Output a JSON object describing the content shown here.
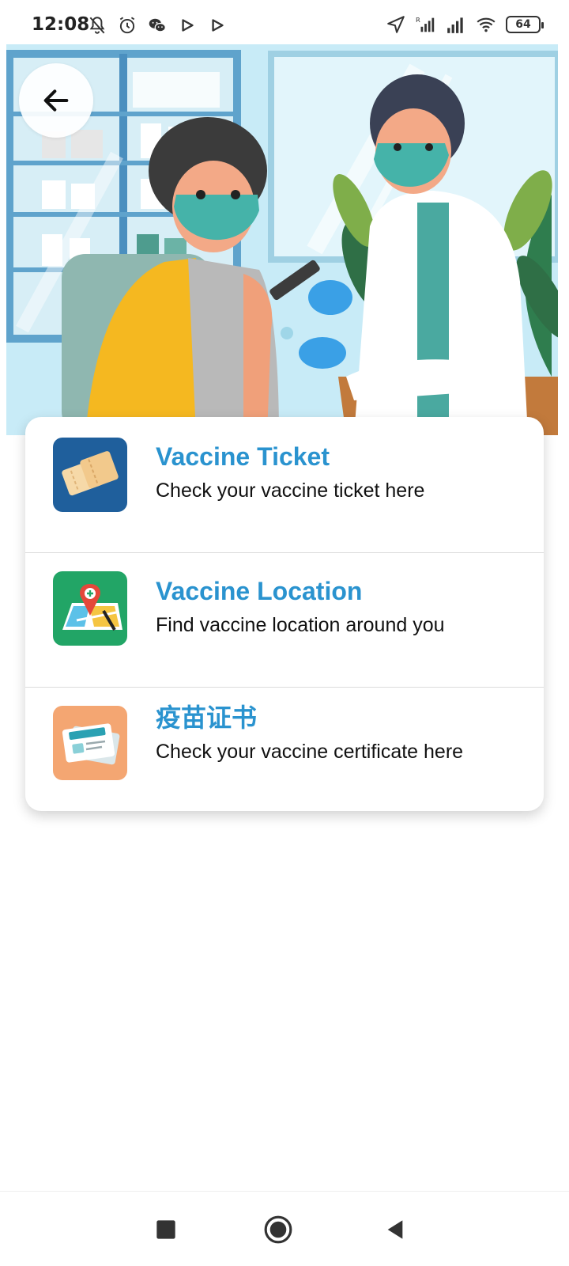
{
  "status_bar": {
    "time": "12:08",
    "battery": "64",
    "left_icons": [
      "bell-off-icon",
      "alarm-icon",
      "wechat-icon",
      "play-icon",
      "play-icon"
    ],
    "right_icons": [
      "location-icon",
      "signal-roaming-icon",
      "signal-icon",
      "wifi-icon",
      "battery-icon"
    ]
  },
  "hero": {
    "illustration": "vaccination-illustration",
    "back_icon": "arrow-left-icon"
  },
  "menu": [
    {
      "title": "Vaccine Ticket",
      "subtitle": "Check your vaccine ticket here",
      "icon": "ticket-icon",
      "tile_color": "#1f5f9c"
    },
    {
      "title": "Vaccine Location",
      "subtitle": "Find vaccine location around you",
      "icon": "map-pin-icon",
      "tile_color": "#22a566"
    },
    {
      "title": "疫苗证书",
      "subtitle": "Check your vaccine certificate here",
      "icon": "certificate-icon",
      "tile_color": "#f4a672"
    }
  ],
  "colors": {
    "accent": "#2a93cf",
    "hero_background": "#c9eaf5"
  },
  "nav_bar": {
    "buttons": [
      "recents-square-icon",
      "home-circle-icon",
      "back-triangle-icon"
    ]
  }
}
